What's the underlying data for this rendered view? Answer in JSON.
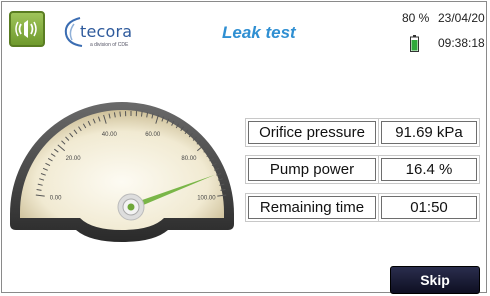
{
  "header": {
    "title": "Leak test",
    "logo_text": "tecora",
    "logo_subtitle": "a division of CDE",
    "battery_percent": "80 %",
    "date": "23/04/20",
    "time": "09:38:18",
    "sound_icon": "speaker-icon",
    "battery_icon": "battery-icon"
  },
  "gauge": {
    "tick_labels": [
      "0.00",
      "20.00",
      "40.00",
      "60.00",
      "80.00",
      "100.00"
    ],
    "range": [
      0,
      100
    ],
    "needle_value": 91.69,
    "needle_color": "#7ab648"
  },
  "readings": [
    {
      "label": "Orifice pressure",
      "value": "91.69 kPa"
    },
    {
      "label": "Pump power",
      "value": "16.4 %"
    },
    {
      "label": "Remaining time",
      "value": "01:50"
    }
  ],
  "actions": {
    "skip_label": "Skip"
  },
  "colors": {
    "title": "#2f8fd2",
    "sound_button": "#7ba236",
    "skip_button": "#1a1c33"
  }
}
